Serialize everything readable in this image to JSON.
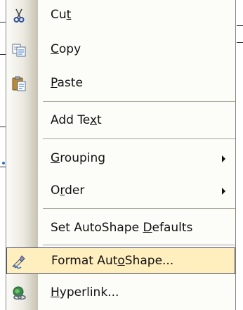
{
  "background": {
    "colors": {
      "line": "#333333",
      "dot": "#2a73c8"
    }
  },
  "menu": {
    "colors": {
      "surface": "#fcfcf9",
      "gutter_dark": "#c7c3b3",
      "highlight": "#ffeebe",
      "highlight_border": "#4b4b6f",
      "separator": "#a6a39a"
    },
    "items": [
      {
        "id": "cut",
        "label_parts": [
          "Cu",
          "t",
          ""
        ],
        "icon": "scissors-icon",
        "submenu": false,
        "highlighted": false
      },
      {
        "id": "copy",
        "label_parts": [
          "",
          "C",
          "opy"
        ],
        "icon": "copy-icon",
        "submenu": false,
        "highlighted": false
      },
      {
        "id": "paste",
        "label_parts": [
          "",
          "P",
          "aste"
        ],
        "icon": "clipboard-icon",
        "submenu": false,
        "highlighted": false
      },
      {
        "id": "add-text",
        "label_parts": [
          "Add Te",
          "x",
          "t"
        ],
        "icon": null,
        "submenu": false,
        "highlighted": false
      },
      {
        "id": "grouping",
        "label_parts": [
          "",
          "G",
          "rouping"
        ],
        "icon": null,
        "submenu": true,
        "highlighted": false
      },
      {
        "id": "order",
        "label_parts": [
          "O",
          "r",
          "der"
        ],
        "icon": null,
        "submenu": true,
        "highlighted": false
      },
      {
        "id": "set-autoshape-defaults",
        "label_parts": [
          "Set AutoShape ",
          "D",
          "efaults"
        ],
        "icon": null,
        "submenu": false,
        "highlighted": false
      },
      {
        "id": "format-autoshape",
        "label_parts": [
          "Format Aut",
          "o",
          "Shape..."
        ],
        "icon": "format-shape-icon",
        "submenu": false,
        "highlighted": true
      },
      {
        "id": "hyperlink",
        "label_parts": [
          "",
          "H",
          "yperlink..."
        ],
        "icon": "hyperlink-globe-icon",
        "submenu": false,
        "highlighted": false
      }
    ]
  }
}
